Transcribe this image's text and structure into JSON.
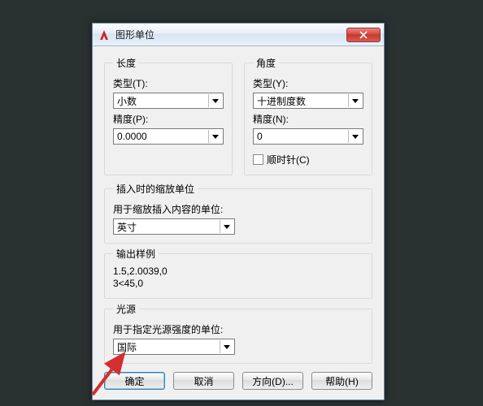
{
  "dialog": {
    "title": "图形单位",
    "length": {
      "legend": "长度",
      "type_label": "类型(T):",
      "type_value": "小数",
      "precision_label": "精度(P):",
      "precision_value": "0.0000"
    },
    "angle": {
      "legend": "角度",
      "type_label": "类型(Y):",
      "type_value": "十进制度数",
      "precision_label": "精度(N):",
      "precision_value": "0",
      "clockwise_label": "顺时针(C)"
    },
    "insert_scale": {
      "legend": "插入时的缩放单位",
      "desc": "用于缩放插入内容的单位:",
      "value": "英寸"
    },
    "sample": {
      "legend": "输出样例",
      "text": "1.5,2.0039,0\n3<45,0"
    },
    "lighting": {
      "legend": "光源",
      "desc": "用于指定光源强度的单位:",
      "value": "国际"
    },
    "buttons": {
      "ok": "确定",
      "cancel": "取消",
      "direction": "方向(D)...",
      "help": "帮助(H)"
    }
  }
}
